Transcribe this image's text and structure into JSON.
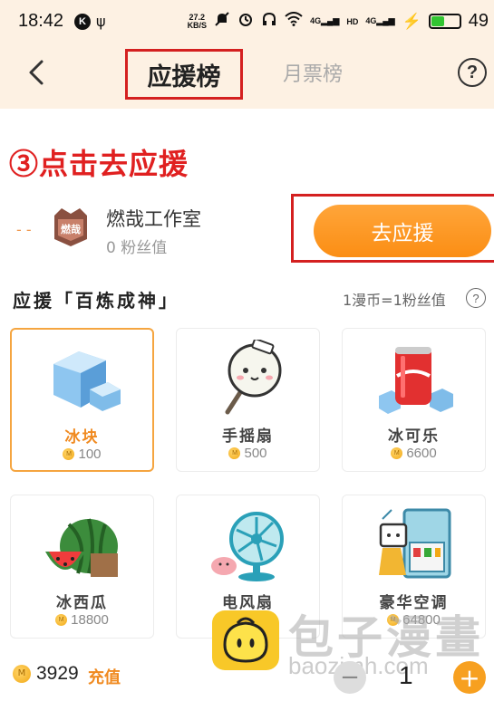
{
  "status_bar": {
    "time": "18:42",
    "k_badge": "K",
    "net_speed_value": "27.2",
    "net_speed_unit": "KB/S",
    "signal_4g_1": "4G",
    "signal_hd": "HD",
    "signal_4g_2": "4G",
    "battery_percent": "49"
  },
  "header": {
    "tab_active": "应援榜",
    "tab_inactive": "月票榜",
    "help": "?"
  },
  "annotation": "③点击去应援",
  "studio": {
    "dash": "- -",
    "logo_text": "燃哉",
    "name": "燃哉工作室",
    "fans": "0 粉丝值",
    "support_button": "去应援"
  },
  "section": {
    "title": "应援「百炼成神」",
    "rate": "1漫币=1粉丝值",
    "rate_help": "?"
  },
  "gifts": [
    {
      "name": "冰块",
      "price": "100",
      "selected": true,
      "icon": "ice-cube-icon"
    },
    {
      "name": "手摇扇",
      "price": "500",
      "selected": false,
      "icon": "hand-fan-icon"
    },
    {
      "name": "冰可乐",
      "price": "6600",
      "selected": false,
      "icon": "cola-can-icon"
    },
    {
      "name": "冰西瓜",
      "price": "18800",
      "selected": false,
      "icon": "watermelon-icon"
    },
    {
      "name": "电风扇",
      "price": "38800",
      "selected": false,
      "icon": "electric-fan-icon"
    },
    {
      "name": "豪华空调",
      "price": "64800",
      "selected": false,
      "icon": "air-conditioner-icon"
    }
  ],
  "coin_glyph": "M",
  "bottom": {
    "balance": "3929",
    "recharge": "充值",
    "qty_minus": "−",
    "quantity": "1",
    "qty_plus": "+"
  },
  "watermark": {
    "text": "包子漫畫",
    "url": "baozimh.com"
  },
  "colors": {
    "accent": "#fb8e14",
    "highlight_box": "#d42020",
    "header_bg": "#fdf1e3"
  }
}
